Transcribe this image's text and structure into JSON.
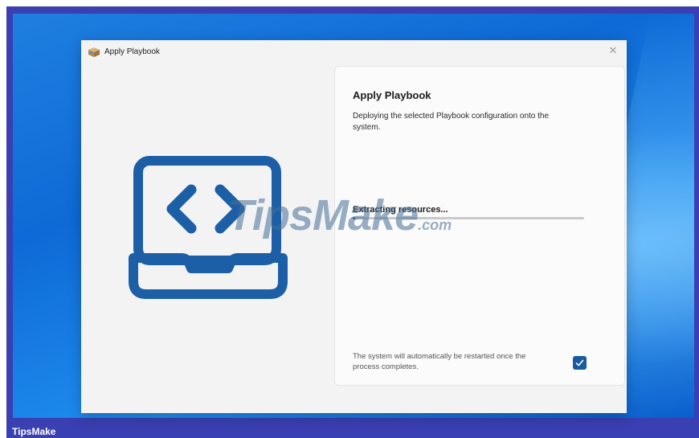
{
  "window": {
    "title": "Apply Playbook",
    "close_glyph": "✕"
  },
  "panel": {
    "heading": "Apply Playbook",
    "description": "Deploying the selected Playbook configuration onto the system.",
    "status": "Extracting resources...",
    "progress_fraction": 0.01,
    "footer_note": "The system will automatically be restarted once the process completes.",
    "auto_restart_checked": true
  },
  "icons": {
    "app": "package-icon",
    "hero": "laptop-code-icon",
    "close": "close-icon",
    "check": "checkmark-icon"
  },
  "colors": {
    "hero_blue": "#1c5fa6",
    "accent": "#1a5aa0",
    "frame": "#3a3fb2"
  },
  "watermark": {
    "main": "TipsMake",
    "suffix": ".com"
  },
  "frame_caption": "TipsMake"
}
